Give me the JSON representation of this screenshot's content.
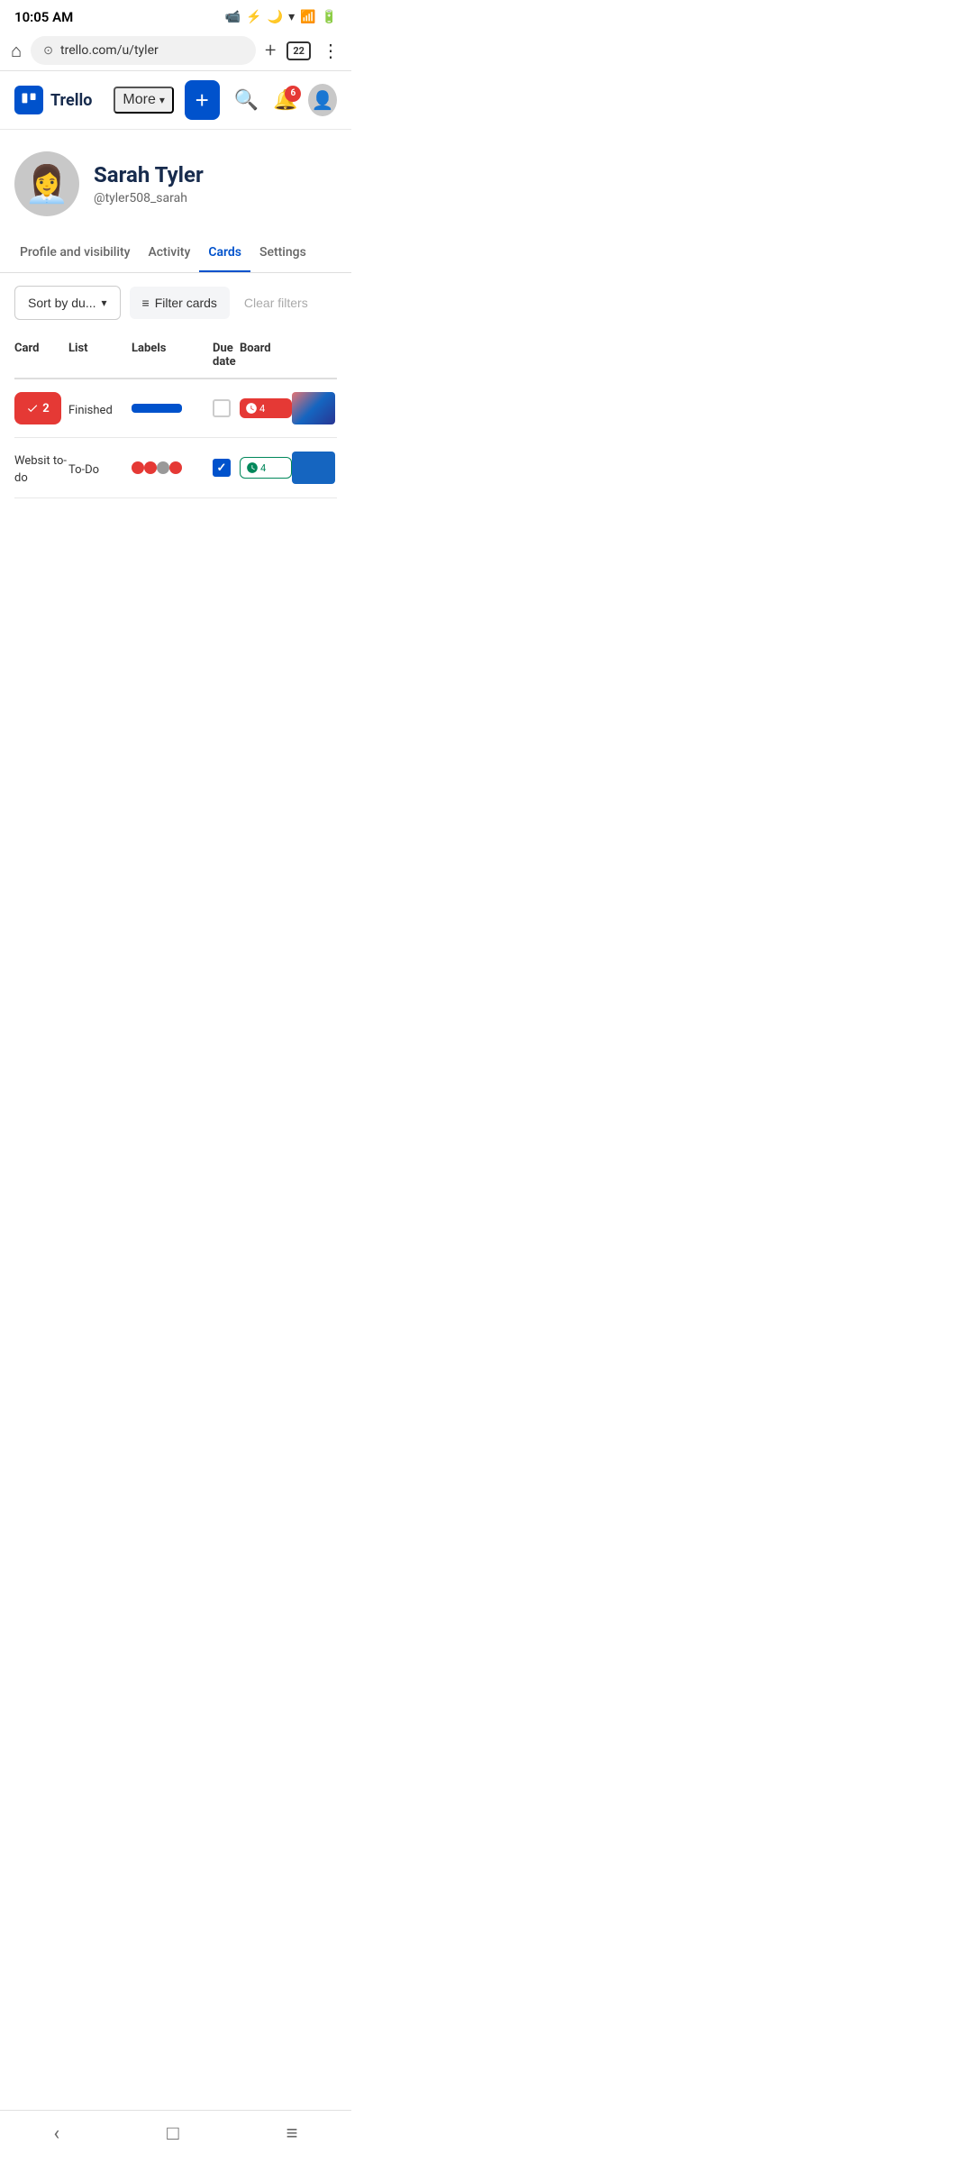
{
  "statusBar": {
    "time": "10:05 AM",
    "tabCount": "22"
  },
  "browserBar": {
    "url": "trello.com/u/tyler",
    "tabs": "22"
  },
  "appHeader": {
    "logoText": "Trello",
    "moreLabel": "More",
    "addLabel": "+",
    "notificationCount": "6"
  },
  "profile": {
    "name": "Sarah Tyler",
    "username": "@tyler508_sarah"
  },
  "tabs": [
    {
      "label": "Profile and visibility",
      "active": false
    },
    {
      "label": "Activity",
      "active": false
    },
    {
      "label": "Cards",
      "active": true
    },
    {
      "label": "Settings",
      "active": false
    }
  ],
  "toolbar": {
    "sortLabel": "Sort by du...",
    "filterLabel": "Filter cards",
    "clearLabel": "Clear filters"
  },
  "table": {
    "headers": [
      "Card",
      "List",
      "Labels",
      "Due date",
      "Board"
    ],
    "rows": [
      {
        "cardBadge": "2",
        "list": "Finished",
        "labelType": "blue-bar",
        "dueDateChecked": false,
        "dueDateType": "red",
        "dueDateText": "4",
        "boardType": "art"
      },
      {
        "cardText": "Websit to-do",
        "list": "To-Do",
        "labelType": "red-dots",
        "dueDateChecked": true,
        "dueDateType": "green",
        "dueDateText": "4",
        "boardType": "blue"
      }
    ]
  },
  "bottomNav": {
    "back": "‹",
    "home": "□",
    "menu": "≡"
  }
}
